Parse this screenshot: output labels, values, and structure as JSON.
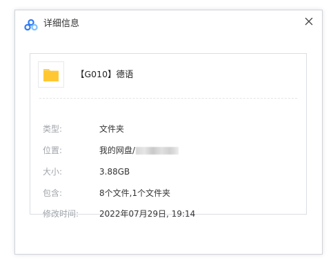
{
  "dialog": {
    "title": "详细信息",
    "logo_icon": "cloud-logo-icon",
    "close_icon": "close-icon"
  },
  "file": {
    "name": "【G010】德语",
    "icon": "folder-icon",
    "folder_color": "#FFD24D"
  },
  "details": [
    {
      "label": "类型:",
      "value": "文件夹"
    },
    {
      "label": "位置:",
      "value": "我的网盘/"
    },
    {
      "label": "大小:",
      "value": "3.88GB"
    },
    {
      "label": "包含:",
      "value": "8个文件,1个文件夹"
    },
    {
      "label": "修改时间:",
      "value": "2022年07月29日, 19:14"
    }
  ],
  "colors": {
    "label": "#A0A4AA",
    "value": "#333333",
    "border": "#CFD3D9",
    "logo_blue": "#2F7BF5",
    "logo_light": "#7FC1FF"
  }
}
